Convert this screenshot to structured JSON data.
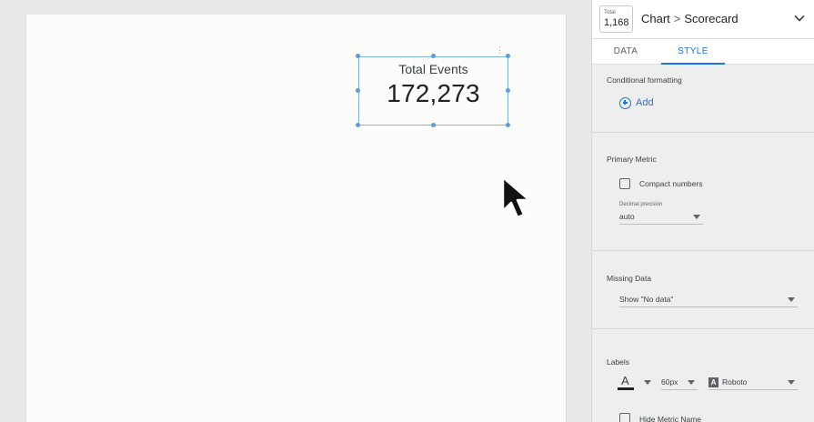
{
  "canvas": {
    "scorecard": {
      "label": "Total Events",
      "value": "172,273"
    },
    "menu_glyph": "⋮"
  },
  "panel": {
    "header": {
      "mini_card": {
        "label": "Total",
        "value": "1,168"
      },
      "breadcrumb_parent": "Chart",
      "breadcrumb_sep": ">",
      "breadcrumb_current": "Scorecard",
      "collapse_icon": "chevron-down-icon"
    },
    "tabs": [
      {
        "label": "DATA",
        "active": false
      },
      {
        "label": "STYLE",
        "active": true
      }
    ],
    "conditional_formatting": {
      "title": "Conditional formatting",
      "add_label": "Add"
    },
    "primary_metric": {
      "title": "Primary Metric",
      "compact_numbers_label": "Compact numbers",
      "compact_numbers_checked": false,
      "decimal_precision_caption": "Decimal precision",
      "decimal_precision_value": "auto"
    },
    "missing_data": {
      "title": "Missing Data",
      "value": "Show \"No data\""
    },
    "labels": {
      "title": "Labels",
      "font_color": "#202124",
      "font_size": "60px",
      "font_family": "Roboto",
      "font_family_badge": "A",
      "font_color_letter": "A",
      "hide_metric_name_label": "Hide Metric Name",
      "hide_metric_name_checked": false
    }
  },
  "colors": {
    "accent": "#1a73e8",
    "selection": "#7fb3e8"
  }
}
